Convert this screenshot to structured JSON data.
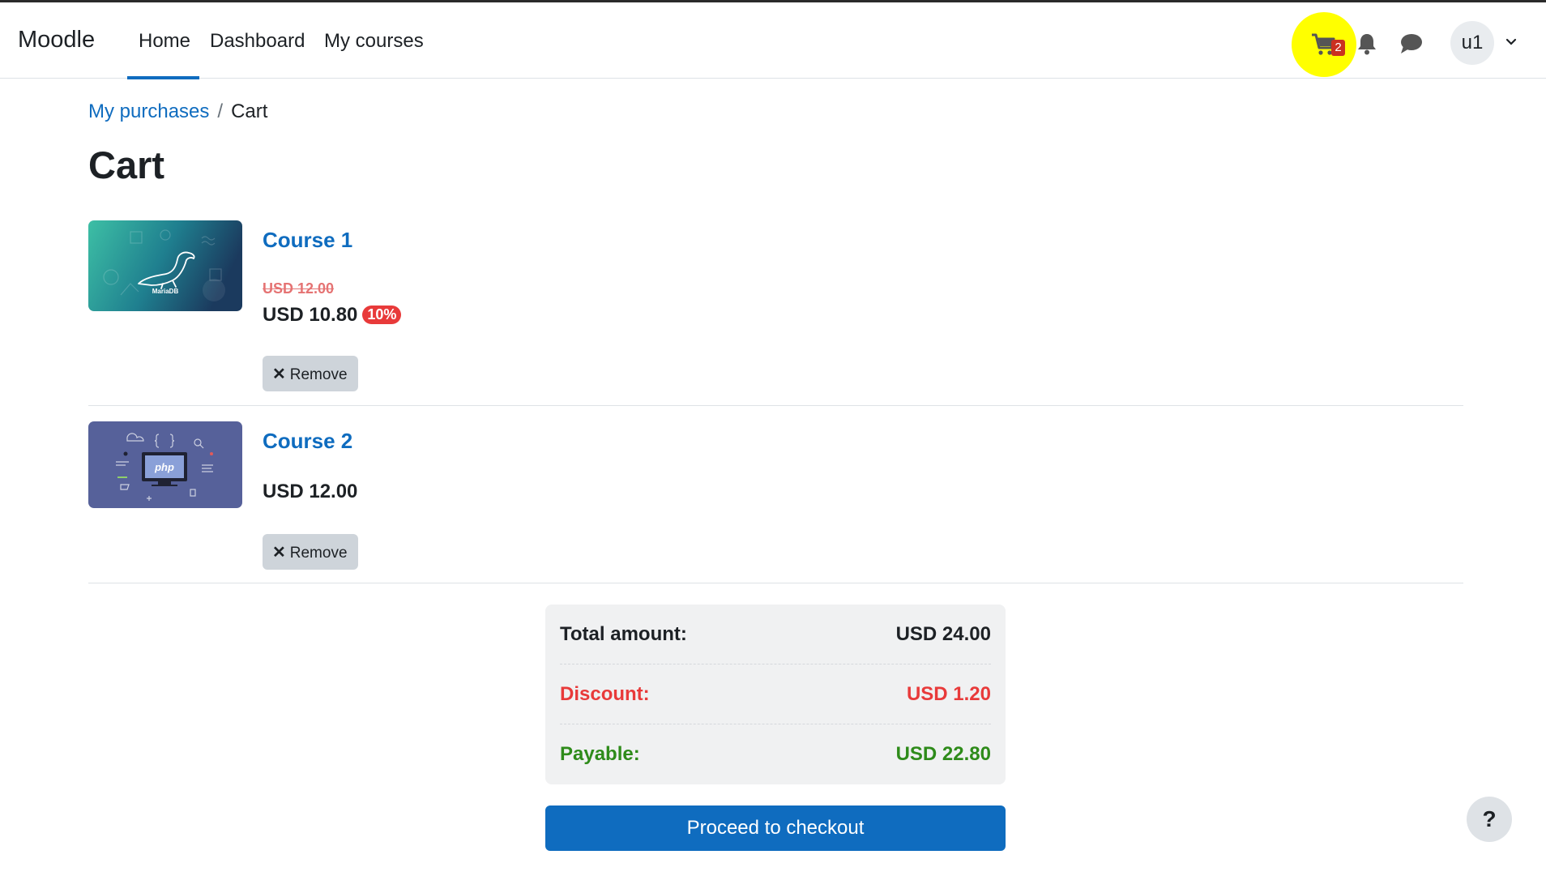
{
  "navbar": {
    "brand": "Moodle",
    "links": [
      {
        "label": "Home",
        "active": true
      },
      {
        "label": "Dashboard",
        "active": false
      },
      {
        "label": "My courses",
        "active": false
      }
    ],
    "cart_count": "2",
    "user_initials": "u1",
    "icons": [
      "shopping-cart-icon",
      "bell-icon",
      "chat-icon",
      "chevron-down-icon"
    ],
    "highlight_color": "#ffff00"
  },
  "breadcrumb": {
    "parent": "My purchases",
    "separator": "/",
    "current": "Cart"
  },
  "page_title": "Cart",
  "items": [
    {
      "name": "Course 1",
      "thumbnail_label": "MariaDB",
      "original_price": "USD 12.00",
      "price": "USD 10.80",
      "discount_badge": "10%",
      "remove_label": "Remove"
    },
    {
      "name": "Course 2",
      "thumbnail_label": "php",
      "price": "USD 12.00",
      "remove_label": "Remove"
    }
  ],
  "summary": {
    "total_label": "Total amount:",
    "total_value": "USD 24.00",
    "discount_label": "Discount:",
    "discount_value": "USD 1.20",
    "payable_label": "Payable:",
    "payable_value": "USD 22.80"
  },
  "checkout_label": "Proceed to checkout",
  "help_label": "?",
  "colors": {
    "primary": "#0f6cbf",
    "discount": "#e83a3a",
    "payable": "#2e8b1a"
  }
}
